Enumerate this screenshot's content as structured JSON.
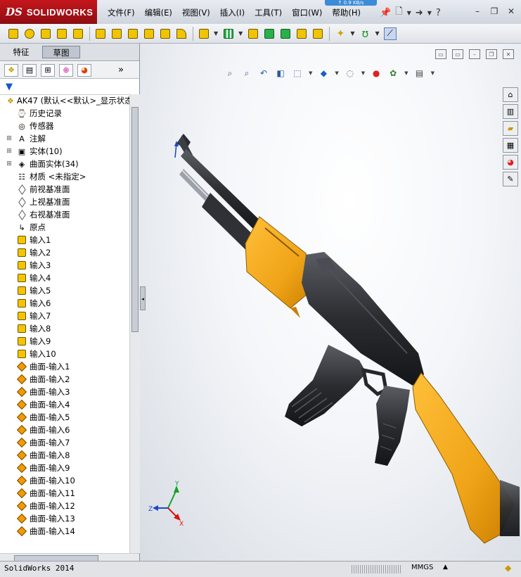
{
  "app": {
    "logo_ds": "DS",
    "logo_name": "SOLIDWORKS",
    "speed_badge": "↑ 0.9 KB/s"
  },
  "menu": [
    "文件(F)",
    "编辑(E)",
    "视图(V)",
    "插入(I)",
    "工具(T)",
    "窗口(W)",
    "帮助(H)"
  ],
  "title_icons": [
    "pin-icon",
    "new-document-icon",
    "open-icon",
    "help-icon"
  ],
  "window_controls": {
    "minimize": "–",
    "restore": "❐",
    "close": "✕"
  },
  "tabs": {
    "feature": "特征",
    "sketch": "草图"
  },
  "tree": {
    "root": "AK47  (默认<<默认>_显示状态",
    "items": [
      {
        "label": "历史记录",
        "icon": "history-icon"
      },
      {
        "label": "传感器",
        "icon": "sensor-icon"
      },
      {
        "label": "注解",
        "icon": "annotation-icon",
        "expandable": true
      },
      {
        "label": "实体(10)",
        "icon": "solid-body-icon",
        "expandable": true
      },
      {
        "label": "曲面实体(34)",
        "icon": "surface-body-icon",
        "expandable": true
      },
      {
        "label": "材质 <未指定>",
        "icon": "material-icon"
      },
      {
        "label": "前视基准面",
        "icon": "plane-icon"
      },
      {
        "label": "上视基准面",
        "icon": "plane-icon"
      },
      {
        "label": "右视基准面",
        "icon": "plane-icon"
      },
      {
        "label": "原点",
        "icon": "origin-icon"
      },
      {
        "label": "输入1",
        "icon": "import-icon"
      },
      {
        "label": "输入2",
        "icon": "import-icon"
      },
      {
        "label": "输入3",
        "icon": "import-icon"
      },
      {
        "label": "输入4",
        "icon": "import-icon"
      },
      {
        "label": "输入5",
        "icon": "import-icon"
      },
      {
        "label": "输入6",
        "icon": "import-icon"
      },
      {
        "label": "输入7",
        "icon": "import-icon"
      },
      {
        "label": "输入8",
        "icon": "import-icon"
      },
      {
        "label": "输入9",
        "icon": "import-icon"
      },
      {
        "label": "输入10",
        "icon": "import-icon"
      },
      {
        "label": "曲面-输入1",
        "icon": "surface-import-icon"
      },
      {
        "label": "曲面-输入2",
        "icon": "surface-import-icon"
      },
      {
        "label": "曲面-输入3",
        "icon": "surface-import-icon"
      },
      {
        "label": "曲面-输入4",
        "icon": "surface-import-icon"
      },
      {
        "label": "曲面-输入5",
        "icon": "surface-import-icon"
      },
      {
        "label": "曲面-输入6",
        "icon": "surface-import-icon"
      },
      {
        "label": "曲面-输入7",
        "icon": "surface-import-icon"
      },
      {
        "label": "曲面-输入8",
        "icon": "surface-import-icon"
      },
      {
        "label": "曲面-输入9",
        "icon": "surface-import-icon"
      },
      {
        "label": "曲面-输入10",
        "icon": "surface-import-icon"
      },
      {
        "label": "曲面-输入11",
        "icon": "surface-import-icon"
      },
      {
        "label": "曲面-输入12",
        "icon": "surface-import-icon"
      },
      {
        "label": "曲面-输入13",
        "icon": "surface-import-icon"
      },
      {
        "label": "曲面-输入14",
        "icon": "surface-import-icon"
      }
    ]
  },
  "triad": {
    "x": "X",
    "y": "Y",
    "z": "Z"
  },
  "status": {
    "app": "SolidWorks 2014",
    "units": "MMGS"
  },
  "colors": {
    "wood": "#f4a81c",
    "metal": "#2b2d31",
    "logo_red": "#c4161c"
  }
}
